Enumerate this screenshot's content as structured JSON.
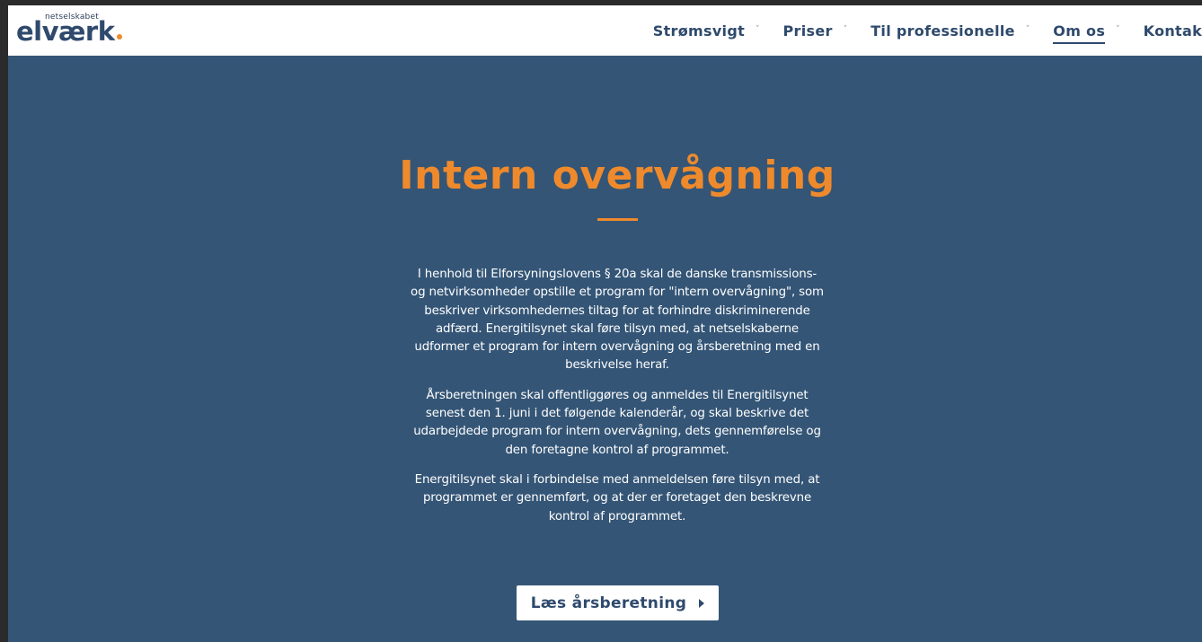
{
  "header": {
    "logo": {
      "subtitle": "netselskabet",
      "name": "elværk"
    },
    "nav": [
      {
        "label": "Strømsvigt",
        "has_dropdown": true,
        "active": false
      },
      {
        "label": "Priser",
        "has_dropdown": true,
        "active": false
      },
      {
        "label": "Til professionelle",
        "has_dropdown": true,
        "active": false
      },
      {
        "label": "Om os",
        "has_dropdown": true,
        "active": true
      },
      {
        "label": "Kontakt",
        "has_dropdown": false,
        "active": false
      }
    ],
    "chevron_icon": "chevron-down-icon"
  },
  "hero": {
    "title": "Intern overvågning",
    "paragraphs": [
      "I henhold til Elforsyningslovens § 20a skal de danske transmissions- og netvirksomheder opstille et program for \"intern overvågning\", som beskriver virksomhedernes tiltag for at forhindre diskriminerende adfærd. Energitilsynet skal føre tilsyn med, at netselskaberne udformer et program for intern overvågning og årsberetning med en beskrivelse heraf.",
      "Årsberetningen skal offentliggøres og anmeldes til Energitilsynet senest den 1. juni i det følgende kalenderår, og skal beskrive det udarbejdede program for intern overvågning, dets gennemførelse og den foretagne kontrol af programmet.",
      "Energitilsynet skal i forbindelse med anmeldelsen føre tilsyn med, at programmet er gennemført, og at der er foretaget den beskrevne kontrol af programmet."
    ],
    "cta_label": "Læs årsberetning",
    "cta_icon": "caret-right-icon"
  },
  "colors": {
    "brand_navy": "#2f4a6d",
    "hero_background": "#345576",
    "accent_orange": "#ee8a2c",
    "header_background": "#ffffff"
  }
}
